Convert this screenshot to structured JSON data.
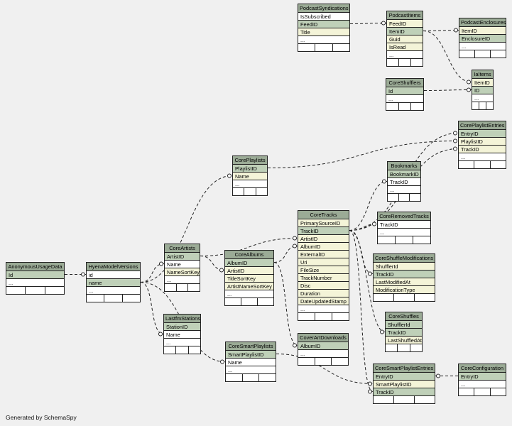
{
  "caption": "Generated by SchemaSpy",
  "tables": [
    {
      "id": "PodcastSyndications",
      "title": "PodcastSyndications",
      "cols": [
        {
          "name": "IsSubscribed",
          "kind": "plain"
        },
        {
          "name": "FeedID",
          "kind": "pk"
        },
        {
          "name": "Title",
          "kind": "fk"
        },
        {
          "name": "...",
          "kind": "plain"
        }
      ]
    },
    {
      "id": "PodcastItems",
      "title": "PodcastItems",
      "cols": [
        {
          "name": "FeedID",
          "kind": "fk"
        },
        {
          "name": "ItemID",
          "kind": "pk"
        },
        {
          "name": "Guid",
          "kind": "fk"
        },
        {
          "name": "IsRead",
          "kind": "fk"
        },
        {
          "name": "...",
          "kind": "plain"
        }
      ]
    },
    {
      "id": "PodcastEnclosures",
      "title": "PodcastEnclosures",
      "cols": [
        {
          "name": "ItemID",
          "kind": "fk"
        },
        {
          "name": "EnclosureID",
          "kind": "pk"
        },
        {
          "name": "...",
          "kind": "plain"
        }
      ]
    },
    {
      "id": "IaItems",
      "title": "IaItems",
      "cols": [
        {
          "name": "ItemID",
          "kind": "fk"
        },
        {
          "name": "ID",
          "kind": "pk"
        },
        {
          "name": "...",
          "kind": "plain"
        }
      ]
    },
    {
      "id": "CoreShufflers",
      "title": "CoreShufflers",
      "cols": [
        {
          "name": "Id",
          "kind": "pk"
        },
        {
          "name": "...",
          "kind": "plain"
        }
      ]
    },
    {
      "id": "CorePlaylistEntries",
      "title": "CorePlaylistEntries",
      "cols": [
        {
          "name": "EntryID",
          "kind": "pk"
        },
        {
          "name": "PlaylistID",
          "kind": "fk"
        },
        {
          "name": "TrackID",
          "kind": "fk"
        },
        {
          "name": "...",
          "kind": "plain"
        }
      ]
    },
    {
      "id": "CorePlaylists",
      "title": "CorePlaylists",
      "cols": [
        {
          "name": "PlaylistID",
          "kind": "pk"
        },
        {
          "name": "Name",
          "kind": "fk"
        },
        {
          "name": "...",
          "kind": "plain"
        }
      ]
    },
    {
      "id": "Bookmarks",
      "title": "Bookmarks",
      "cols": [
        {
          "name": "BookmarkID",
          "kind": "pk"
        },
        {
          "name": "TrackID",
          "kind": "plain"
        },
        {
          "name": "...",
          "kind": "plain"
        }
      ]
    },
    {
      "id": "CoreTracks",
      "title": "CoreTracks",
      "cols": [
        {
          "name": "PrimarySourceID",
          "kind": "fk"
        },
        {
          "name": "TrackID",
          "kind": "pk"
        },
        {
          "name": "ArtistID",
          "kind": "fk"
        },
        {
          "name": "AlbumID",
          "kind": "fk"
        },
        {
          "name": "ExternalID",
          "kind": "fk"
        },
        {
          "name": "Uri",
          "kind": "fk"
        },
        {
          "name": "FileSize",
          "kind": "fk"
        },
        {
          "name": "TrackNumber",
          "kind": "fk"
        },
        {
          "name": "Disc",
          "kind": "fk"
        },
        {
          "name": "Duration",
          "kind": "fk"
        },
        {
          "name": "DateUpdatedStamp",
          "kind": "fk"
        },
        {
          "name": "...",
          "kind": "plain"
        }
      ]
    },
    {
      "id": "CoreRemovedTracks",
      "title": "CoreRemovedTracks",
      "cols": [
        {
          "name": "TrackID",
          "kind": "plain"
        },
        {
          "name": "...",
          "kind": "plain"
        }
      ]
    },
    {
      "id": "CoreShuffleModifications",
      "title": "CoreShuffleModifications",
      "cols": [
        {
          "name": "ShufflerId",
          "kind": "fk"
        },
        {
          "name": "TrackID",
          "kind": "pk"
        },
        {
          "name": "LastModifiedAt",
          "kind": "fk"
        },
        {
          "name": "ModificationType",
          "kind": "fk"
        }
      ]
    },
    {
      "id": "CoreArtists",
      "title": "CoreArtists",
      "cols": [
        {
          "name": "ArtistID",
          "kind": "pk"
        },
        {
          "name": "Name",
          "kind": "plain"
        },
        {
          "name": "NameSortKey",
          "kind": "fk"
        },
        {
          "name": "...",
          "kind": "plain"
        }
      ]
    },
    {
      "id": "CoreAlbums",
      "title": "CoreAlbums",
      "cols": [
        {
          "name": "AlbumID",
          "kind": "pk"
        },
        {
          "name": "ArtistID",
          "kind": "fk"
        },
        {
          "name": "TitleSortKey",
          "kind": "fk"
        },
        {
          "name": "ArtistNameSortKey",
          "kind": "fk"
        },
        {
          "name": "...",
          "kind": "plain"
        }
      ]
    },
    {
      "id": "AnonymousUsageData",
      "title": "AnonymousUsageData",
      "cols": [
        {
          "name": "Id",
          "kind": "pk"
        },
        {
          "name": "...",
          "kind": "plain"
        }
      ]
    },
    {
      "id": "HyenaModelVersions",
      "title": "HyenaModelVersions",
      "cols": [
        {
          "name": "id",
          "kind": "plain"
        },
        {
          "name": "name",
          "kind": "pk"
        },
        {
          "name": "...",
          "kind": "plain"
        }
      ]
    },
    {
      "id": "LastfmStations",
      "title": "LastfmStations",
      "cols": [
        {
          "name": "StationID",
          "kind": "pk"
        },
        {
          "name": "Name",
          "kind": "plain"
        },
        {
          "name": "...",
          "kind": "plain"
        }
      ]
    },
    {
      "id": "CoreShuffles",
      "title": "CoreShuffles",
      "cols": [
        {
          "name": "ShufflerId",
          "kind": "pk"
        },
        {
          "name": "TrackID",
          "kind": "pk"
        },
        {
          "name": "LastShuffledAt",
          "kind": "fk"
        }
      ]
    },
    {
      "id": "CoverArtDownloads",
      "title": "CoverArtDownloads",
      "cols": [
        {
          "name": "AlbumID",
          "kind": "pk"
        },
        {
          "name": "...",
          "kind": "plain"
        }
      ]
    },
    {
      "id": "CoreSmartPlaylists",
      "title": "CoreSmartPlaylists",
      "cols": [
        {
          "name": "SmartPlaylistID",
          "kind": "pk"
        },
        {
          "name": "Name",
          "kind": "plain"
        },
        {
          "name": "...",
          "kind": "plain"
        }
      ]
    },
    {
      "id": "CoreSmartPlaylistEntries",
      "title": "CoreSmartPlaylistEntries",
      "cols": [
        {
          "name": "EntryID",
          "kind": "pk"
        },
        {
          "name": "SmartPlaylistID",
          "kind": "fk"
        },
        {
          "name": "TrackID",
          "kind": "pk"
        }
      ]
    },
    {
      "id": "CoreConfiguration",
      "title": "CoreConfiguration",
      "cols": [
        {
          "name": "EntryID",
          "kind": "pk"
        },
        {
          "name": "...",
          "kind": "plain"
        }
      ]
    }
  ],
  "relations": [
    {
      "from": "PodcastSyndications",
      "from_col": "FeedID",
      "to": "PodcastItems",
      "to_col": "FeedID"
    },
    {
      "from": "PodcastItems",
      "from_col": "ItemID",
      "to": "PodcastEnclosures",
      "to_col": "ItemID"
    },
    {
      "from": "PodcastItems",
      "from_col": "ItemID",
      "to": "IaItems",
      "to_col": "ItemID"
    },
    {
      "from": "CoreShufflers",
      "from_col": "Id",
      "to": "IaItems",
      "to_col": "ID"
    },
    {
      "from": "CorePlaylists",
      "from_col": "PlaylistID",
      "to": "CorePlaylistEntries",
      "to_col": "PlaylistID"
    },
    {
      "from": "CoreTracks",
      "from_col": "TrackID",
      "to": "CorePlaylistEntries",
      "to_col": "EntryID"
    },
    {
      "from": "CoreTracks",
      "from_col": "TrackID",
      "to": "CorePlaylistEntries",
      "to_col": "TrackID"
    },
    {
      "from": "CoreTracks",
      "from_col": "TrackID",
      "to": "Bookmarks",
      "to_col": "TrackID"
    },
    {
      "from": "CoreTracks",
      "from_col": "TrackID",
      "to": "CoreRemovedTracks",
      "to_col": "TrackID"
    },
    {
      "from": "CoreTracks",
      "from_col": "TrackID",
      "to": "CoreShuffleModifications",
      "to_col": "TrackID"
    },
    {
      "from": "CoreTracks",
      "from_col": "TrackID",
      "to": "CoreShuffles",
      "to_col": "TrackID"
    },
    {
      "from": "CoreTracks",
      "from_col": "TrackID",
      "to": "CoreSmartPlaylistEntries",
      "to_col": "TrackID"
    },
    {
      "from": "CoreArtists",
      "from_col": "ArtistID",
      "to": "CoreTracks",
      "to_col": "ArtistID"
    },
    {
      "from": "CoreAlbums",
      "from_col": "AlbumID",
      "to": "CoreTracks",
      "to_col": "AlbumID"
    },
    {
      "from": "CoreAlbums",
      "from_col": "AlbumID",
      "to": "CoverArtDownloads",
      "to_col": "AlbumID"
    },
    {
      "from": "CoreArtists",
      "from_col": "ArtistID",
      "to": "CoreAlbums",
      "to_col": "ArtistID"
    },
    {
      "from": "AnonymousUsageData",
      "from_col": "Id",
      "to": "HyenaModelVersions",
      "to_col": "id"
    },
    {
      "from": "HyenaModelVersions",
      "from_col": "name",
      "to": "CorePlaylists",
      "to_col": "Name"
    },
    {
      "from": "HyenaModelVersions",
      "from_col": "name",
      "to": "CoreArtists",
      "to_col": "Name"
    },
    {
      "from": "HyenaModelVersions",
      "from_col": "name",
      "to": "LastfmStations",
      "to_col": "Name"
    },
    {
      "from": "HyenaModelVersions",
      "from_col": "name",
      "to": "CoreSmartPlaylists",
      "to_col": "Name"
    },
    {
      "from": "CoreSmartPlaylists",
      "from_col": "SmartPlaylistID",
      "to": "CoreSmartPlaylistEntries",
      "to_col": "SmartPlaylistID"
    },
    {
      "from": "CoreConfiguration",
      "from_col": "EntryID",
      "to": "CoreSmartPlaylistEntries",
      "to_col": "EntryID"
    }
  ]
}
